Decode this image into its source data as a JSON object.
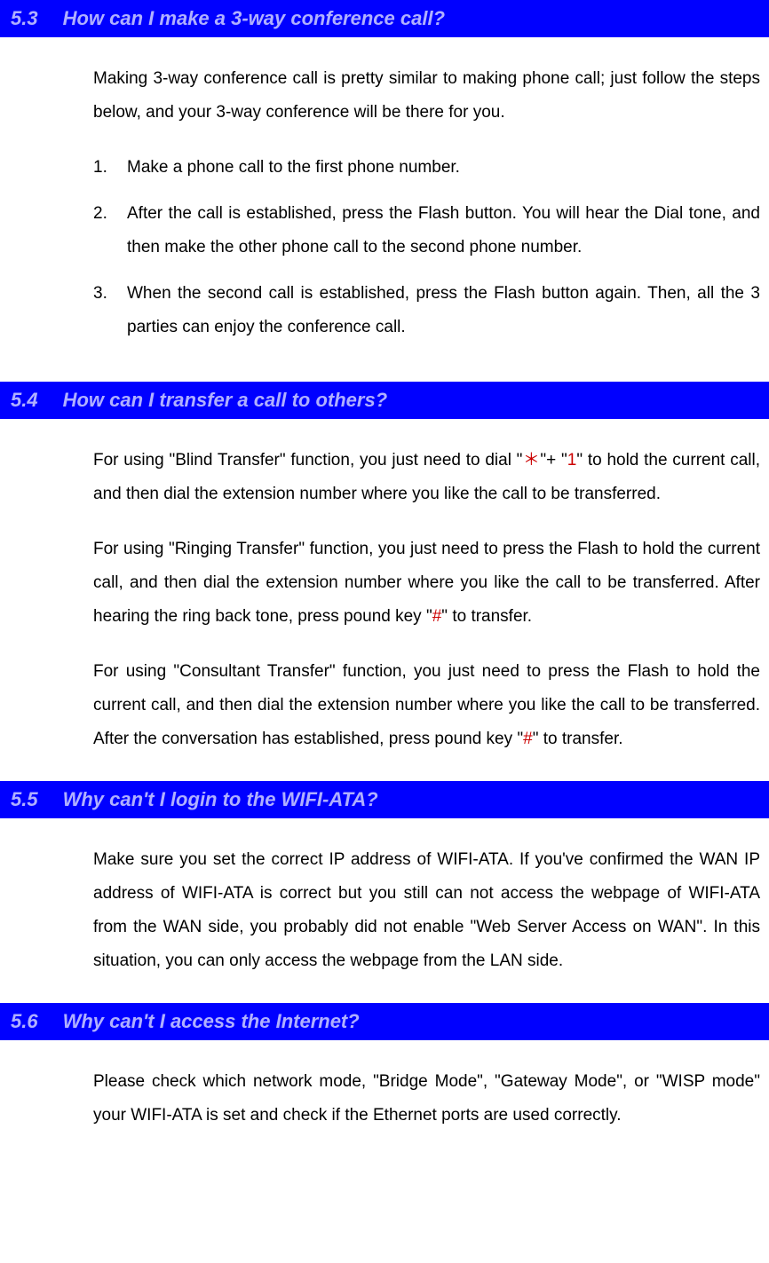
{
  "s53": {
    "num": "5.3",
    "title": "How can I make a 3-way conference call?",
    "intro": "Making 3-way conference call is pretty similar to making phone call; just follow the steps below, and your 3-way conference will be there for you.",
    "steps": [
      "Make a phone call to the first phone number.",
      "After the call is established, press the Flash button. You will hear the Dial tone, and then make the other phone call to the second phone number.",
      "When the second call is established, press the Flash button again. Then, all the 3 parties can enjoy the conference call."
    ]
  },
  "s54": {
    "num": "5.4",
    "title": "How can I transfer a call to others?",
    "p1a": "For using \"Blind Transfer\" function, you just need to dial \"",
    "p1b": "＊",
    "p1c": "\"+ \"",
    "p1d": "1",
    "p1e": "\" to hold the current call, and then dial the extension number where you like the call to be transferred.",
    "p2a": "For using \"Ringing Transfer\" function, you just need to press the Flash to hold the current call, and then dial the extension number where you like the call to be transferred. After hearing the ring back tone, press pound key \"",
    "p2b": "#",
    "p2c": "\" to transfer.",
    "p3a": "For using \"Consultant Transfer\" function, you just need to press the Flash to hold the current call, and then dial the extension number where you like the call to be transferred. After the conversation has established, press pound key \"",
    "p3b": "#",
    "p3c": "\" to transfer."
  },
  "s55": {
    "num": "5.5",
    "title": "Why can't I login to the WIFI-ATA?",
    "p1": "Make sure you set the correct IP address of WIFI-ATA. If you've confirmed the WAN IP address of WIFI-ATA is correct but you still can not access the webpage of WIFI-ATA from the WAN side, you probably did not enable \"Web Server Access on WAN\". In this situation, you can only access the webpage from the LAN side."
  },
  "s56": {
    "num": "5.6",
    "title": "Why can't I access the Internet?",
    "p1": "Please check which network mode, \"Bridge Mode\", \"Gateway Mode\", or \"WISP mode\" your WIFI-ATA is set and check if the Ethernet ports are used correctly."
  }
}
